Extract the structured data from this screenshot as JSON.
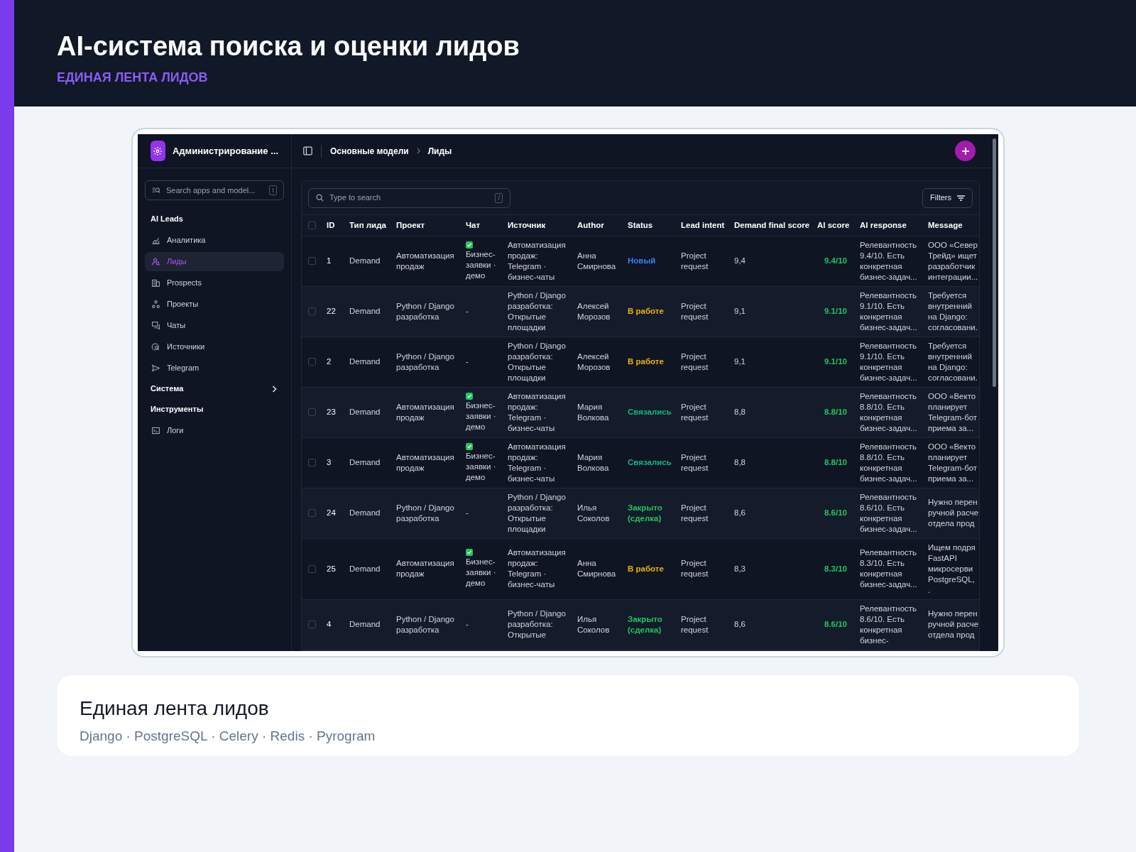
{
  "page": {
    "title": "AI-система поиска и оценки лидов",
    "subtitle": "ЕДИНАЯ ЛЕНТА ЛИДОВ"
  },
  "app": {
    "brand": "Администрирование ...",
    "breadcrumbs": [
      "Основные модели",
      "Лиды"
    ],
    "sidebar": {
      "search": {
        "placeholder": "Search apps and model...",
        "shortcut": "t"
      },
      "sections": [
        {
          "title": "AI Leads",
          "expanded": true,
          "items": [
            {
              "label": "Аналитика",
              "selected": false
            },
            {
              "label": "Лиды",
              "selected": true
            },
            {
              "label": "Prospects",
              "selected": false
            },
            {
              "label": "Проекты",
              "selected": false
            },
            {
              "label": "Чаты",
              "selected": false
            },
            {
              "label": "Источники",
              "selected": false
            },
            {
              "label": "Telegram",
              "selected": false
            }
          ]
        },
        {
          "title": "Система",
          "expanded": false
        },
        {
          "title": "Инструменты",
          "expanded": true,
          "items": [
            {
              "label": "Логи",
              "selected": false
            }
          ]
        }
      ]
    },
    "search": {
      "placeholder": "Type to search",
      "shortcut": "/"
    },
    "filters_button": "Filters",
    "table": {
      "all_selected": false,
      "columns": [
        "ID",
        "Тип лида",
        "Проект",
        "Чат",
        "Источник",
        "Author",
        "Status",
        "Lead intent",
        "Demand final score",
        "AI score",
        "AI response",
        "Message"
      ],
      "rows": [
        {
          "selected": false,
          "id": "1",
          "type": "Demand",
          "project": "Автоматизация продаж",
          "chat": {
            "checked": true,
            "text": "Бизнес-заявки · демо"
          },
          "source": "Автоматизация продаж: Telegram · бизнес-чаты",
          "author": "Анна Смирнова",
          "status": {
            "text": "Новый",
            "kind": "new"
          },
          "intent": "Project request",
          "demand": "9,4",
          "ai_score": "9.4/10",
          "ai_response": "Релевантность 9.4/10. Есть конкретная бизнес-задач...",
          "message": "ООО «Север Трейд» ищет разработчик интеграции..."
        },
        {
          "selected": false,
          "id": "22",
          "type": "Demand",
          "project": "Python / Django разработка",
          "chat": {
            "checked": false,
            "text": "-"
          },
          "source": "Python / Django разработка: Открытые площадки",
          "author": "Алексей Морозов",
          "status": {
            "text": "В работе",
            "kind": "in_progress"
          },
          "intent": "Project request",
          "demand": "9,1",
          "ai_score": "9.1/10",
          "ai_response": "Релевантность 9.1/10. Есть конкретная бизнес-задач...",
          "message": "Требуется внутренний на Django: согласовани."
        },
        {
          "selected": false,
          "id": "2",
          "type": "Demand",
          "project": "Python / Django разработка",
          "chat": {
            "checked": false,
            "text": "-"
          },
          "source": "Python / Django разработка: Открытые площадки",
          "author": "Алексей Морозов",
          "status": {
            "text": "В работе",
            "kind": "in_progress"
          },
          "intent": "Project request",
          "demand": "9,1",
          "ai_score": "9.1/10",
          "ai_response": "Релевантность 9.1/10. Есть конкретная бизнес-задач...",
          "message": "Требуется внутренний на Django: согласовани."
        },
        {
          "selected": false,
          "id": "23",
          "type": "Demand",
          "project": "Автоматизация продаж",
          "chat": {
            "checked": true,
            "text": "Бизнес-заявки · демо"
          },
          "source": "Автоматизация продаж: Telegram · бизнес-чаты",
          "author": "Мария Волкова",
          "status": {
            "text": "Связались",
            "kind": "contacted"
          },
          "intent": "Project request",
          "demand": "8,8",
          "ai_score": "8.8/10",
          "ai_response": "Релевантность 8.8/10. Есть конкретная бизнес-задач...",
          "message": "ООО «Векто планирует Telegram-бот приема за..."
        },
        {
          "selected": false,
          "id": "3",
          "type": "Demand",
          "project": "Автоматизация продаж",
          "chat": {
            "checked": true,
            "text": "Бизнес-заявки · демо"
          },
          "source": "Автоматизация продаж: Telegram · бизнес-чаты",
          "author": "Мария Волкова",
          "status": {
            "text": "Связались",
            "kind": "contacted"
          },
          "intent": "Project request",
          "demand": "8,8",
          "ai_score": "8.8/10",
          "ai_response": "Релевантность 8.8/10. Есть конкретная бизнес-задач...",
          "message": "ООО «Векто планирует Telegram-бот приема за..."
        },
        {
          "selected": false,
          "id": "24",
          "type": "Demand",
          "project": "Python / Django разработка",
          "chat": {
            "checked": false,
            "text": "-"
          },
          "source": "Python / Django разработка: Открытые площадки",
          "author": "Илья Соколов",
          "status": {
            "text": "Закрыто (сделка)",
            "kind": "closed"
          },
          "intent": "Project request",
          "demand": "8,6",
          "ai_score": "8.6/10",
          "ai_response": "Релевантность 8.6/10. Есть конкретная бизнес-задач...",
          "message": "Нужно перен ручной расче отдела прод"
        },
        {
          "selected": false,
          "id": "25",
          "type": "Demand",
          "project": "Автоматизация продаж",
          "chat": {
            "checked": true,
            "text": "Бизнес-заявки · демо"
          },
          "source": "Автоматизация продаж: Telegram · бизнес-чаты",
          "author": "Анна Смирнова",
          "status": {
            "text": "В работе",
            "kind": "in_progress"
          },
          "intent": "Project request",
          "demand": "8,3",
          "ai_score": "8.3/10",
          "ai_response": "Релевантность 8.3/10. Есть конкретная бизнес-задач...",
          "message": "Ищем подря FastAPI микросерви PostgreSQL, ."
        },
        {
          "selected": false,
          "id": "4",
          "type": "Demand",
          "project": "Python / Django разработка",
          "chat": {
            "checked": false,
            "text": "-"
          },
          "source": "Python / Django разработка: Открытые",
          "author": "Илья Соколов",
          "status": {
            "text": "Закрыто (сделка)",
            "kind": "closed"
          },
          "intent": "Project request",
          "demand": "8,6",
          "ai_score": "8.6/10",
          "ai_response": "Релевантность 8.6/10. Есть конкретная бизнес-",
          "message": "Нужно перен ручной расче отдела прод"
        }
      ]
    }
  },
  "card": {
    "title": "Единая лента лидов",
    "stack": "Django · PostgreSQL · Celery · Redis · Pyrogram"
  }
}
